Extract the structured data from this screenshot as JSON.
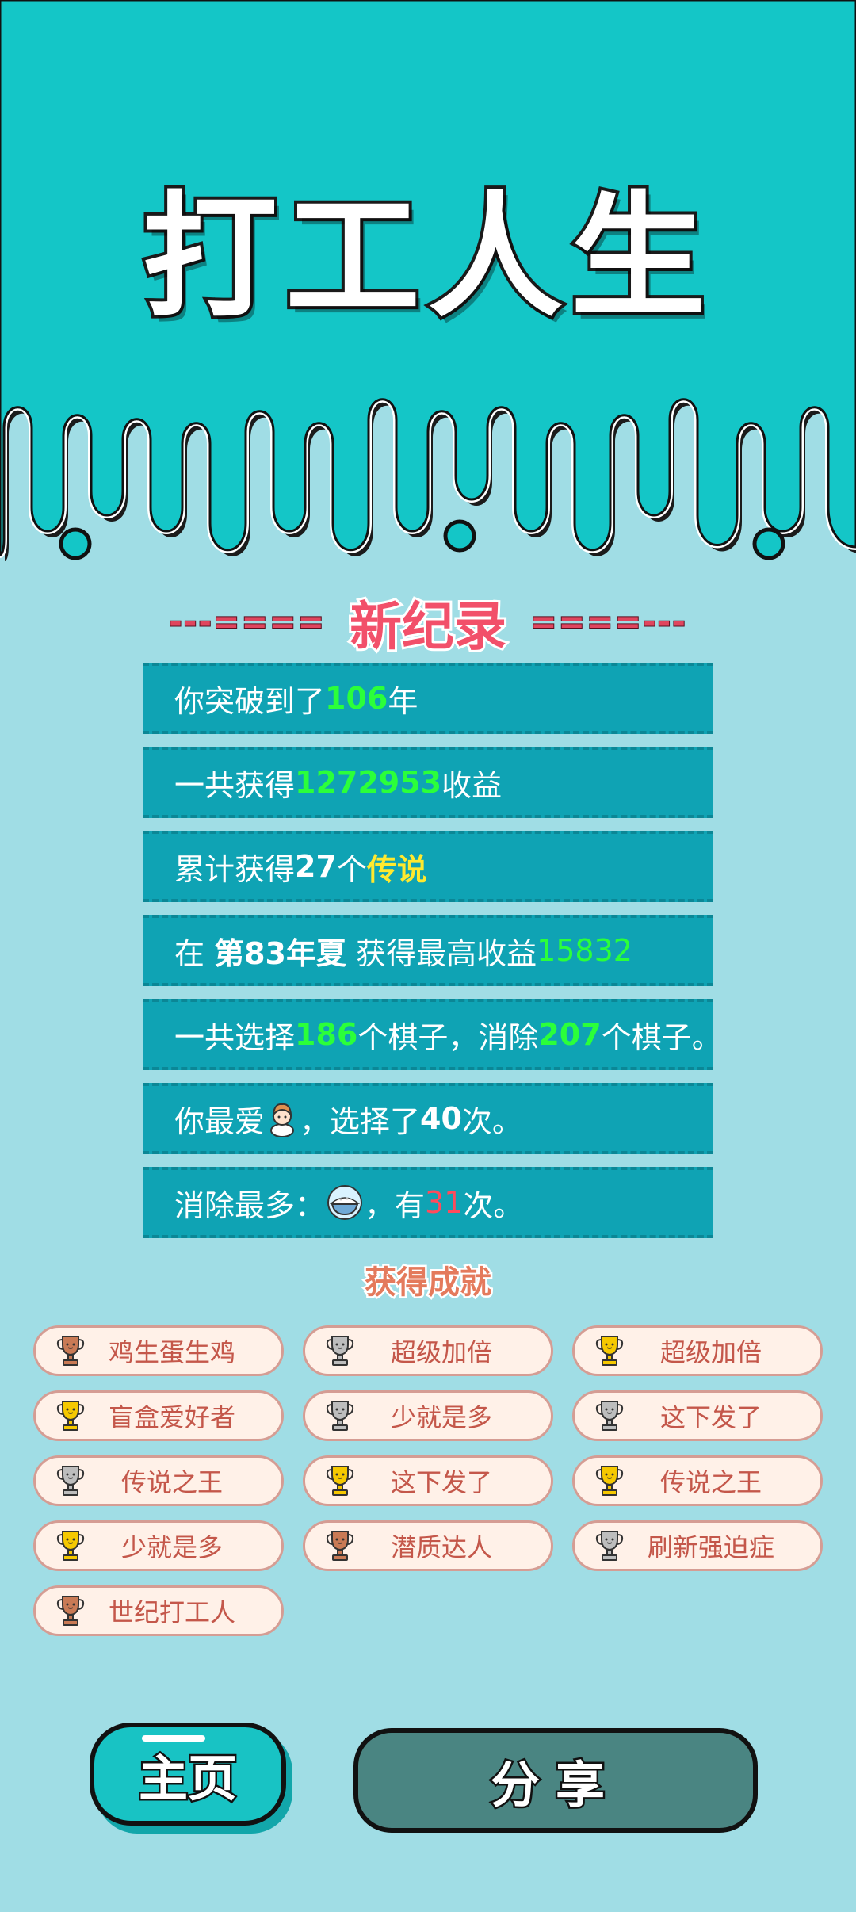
{
  "app": {
    "title": "打工人生"
  },
  "record": {
    "deco_left": "---====",
    "deco_right": "====---",
    "title": "新纪录"
  },
  "stats": {
    "row1": {
      "prefix": "你突破到了",
      "years": "106",
      "suffix": "年"
    },
    "row2": {
      "prefix": "一共获得",
      "income": "1272953",
      "suffix": "收益"
    },
    "row3": {
      "prefix": "累计获得",
      "count": "27",
      "mid": "个",
      "legend": "传说"
    },
    "row4": {
      "prefix": "在 ",
      "season": "第83年夏",
      "mid": " 获得最高收益",
      "best": "15832"
    },
    "row5": {
      "prefix": "一共选择",
      "chosen": "186",
      "mid": "个棋子，消除",
      "removed": "207",
      "suffix": "个棋子。"
    },
    "row6": {
      "prefix": "你最爱",
      "mid": "，选择了",
      "times": "40",
      "suffix": "次。",
      "icon": "character-icon"
    },
    "row7": {
      "prefix": "消除最多：",
      "mid": "，有",
      "times": "31",
      "suffix": "次。",
      "icon": "rice-bowl-icon"
    }
  },
  "achievements": {
    "title": "获得成就",
    "items": [
      {
        "label": "鸡生蛋生鸡",
        "tier": "bronze"
      },
      {
        "label": "超级加倍",
        "tier": "silver"
      },
      {
        "label": "超级加倍",
        "tier": "gold"
      },
      {
        "label": "盲盒爱好者",
        "tier": "gold"
      },
      {
        "label": "少就是多",
        "tier": "silver"
      },
      {
        "label": "这下发了",
        "tier": "silver"
      },
      {
        "label": "传说之王",
        "tier": "silver"
      },
      {
        "label": "这下发了",
        "tier": "gold"
      },
      {
        "label": "传说之王",
        "tier": "gold"
      },
      {
        "label": "少就是多",
        "tier": "gold"
      },
      {
        "label": "潜质达人",
        "tier": "bronze"
      },
      {
        "label": "刷新强迫症",
        "tier": "silver"
      },
      {
        "label": "世纪打工人",
        "tier": "bronze"
      }
    ]
  },
  "buttons": {
    "home": "主页",
    "share": "分享"
  },
  "colors": {
    "header_bg": "#14c6c7",
    "body_bg": "#a0dde5",
    "row_bg": "#0fa3b4",
    "highlight_green": "#2bff3a",
    "highlight_yellow": "#ffe92e",
    "highlight_red": "#ff4b5c",
    "record_red": "#f2506a",
    "gold": "#f5c800",
    "silver": "#bdbdbd",
    "bronze": "#c97a55"
  }
}
